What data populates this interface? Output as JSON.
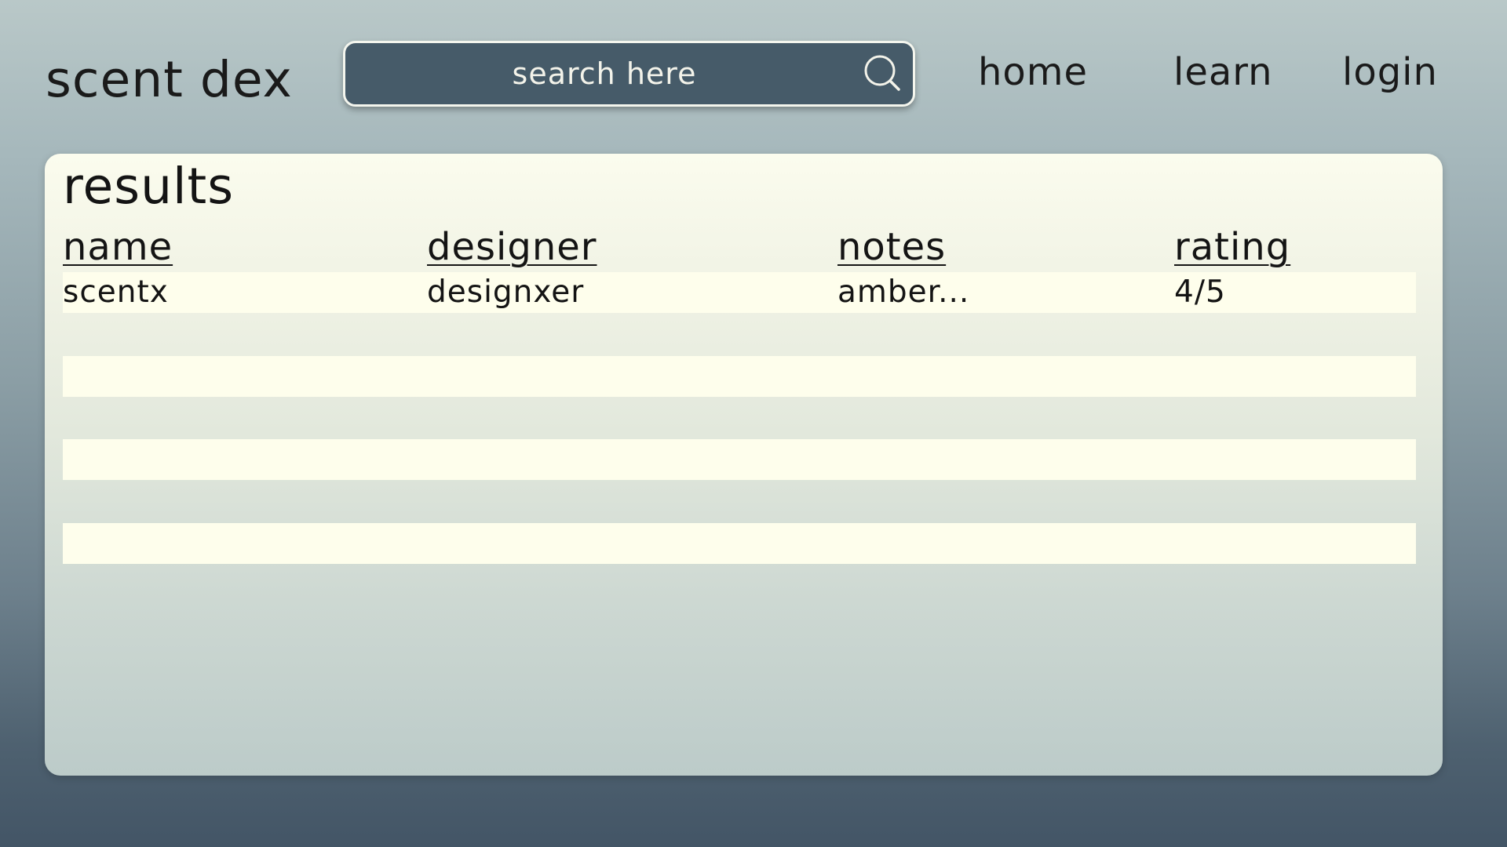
{
  "app": {
    "logo": "scent dex"
  },
  "search": {
    "placeholder": "search here",
    "icon": "search-icon"
  },
  "nav": {
    "home": "home",
    "learn": "learn",
    "login": "login"
  },
  "results": {
    "title": "results",
    "columns": {
      "name": "name",
      "designer": "designer",
      "notes": "notes",
      "rating": "rating"
    },
    "rows": [
      {
        "name": "scentx",
        "designer": "designxer",
        "notes": "amber...",
        "rating": "4/5"
      },
      {
        "name": "",
        "designer": "",
        "notes": "",
        "rating": ""
      },
      {
        "name": "",
        "designer": "",
        "notes": "",
        "rating": ""
      },
      {
        "name": "",
        "designer": "",
        "notes": "",
        "rating": ""
      }
    ]
  },
  "colors": {
    "search_bg": "#465b69",
    "row_bg": "#fefeec",
    "panel_top": "#fbfcee",
    "page_bottom": "#435566"
  }
}
